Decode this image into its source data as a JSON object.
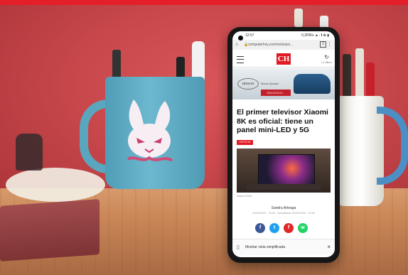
{
  "scene": {
    "description_colors": {
      "wall": "#c9484c",
      "desk": "#c98657"
    }
  },
  "phone": {
    "status_time": "12:57",
    "status_right": "0,2KB/s ▲ ᵢ 𝗹 ⊛ ▮",
    "url": "computerhoy.com/noticias/...",
    "tab_count": "3",
    "site_logo": "CH",
    "refresh_label": "Lo Último",
    "ad": {
      "brand": "NISSAN",
      "subtitle": "Nissan Qashqai",
      "cta": "SOLICITA O..."
    },
    "headline": "El primer televisor Xiaomi 8K es oficial: tiene un panel mini-LED y 5G",
    "tag": "NOTICIA",
    "photo_credit": "Xiaomi China",
    "author": "Sandra Arteaga",
    "dates": "29/09/2020 · 15:20 · Actualizado 29/09/2020 · 15:28",
    "shares": [
      "f",
      "t",
      "f",
      "w"
    ],
    "footer_label": "Mostrar vista simplificada"
  }
}
